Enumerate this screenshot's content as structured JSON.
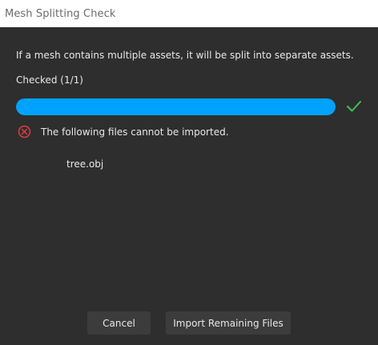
{
  "window": {
    "title": "Mesh Splitting Check"
  },
  "content": {
    "description": "If a mesh contains multiple assets, it will be split into separate assets.",
    "status": "Checked (1/1)",
    "progress": {
      "value": 1,
      "max": 1,
      "fill_color": "#00a2ff"
    },
    "error_message": "The following files cannot be imported.",
    "failed_files": [
      "tree.obj"
    ]
  },
  "buttons": {
    "cancel_label": "Cancel",
    "import_label": "Import Remaining Files"
  },
  "colors": {
    "background": "#2e2e2e",
    "accent": "#00a2ff",
    "success": "#3cc35a",
    "error": "#e03c3c"
  },
  "icons": {
    "success": "check-icon",
    "error": "error-circle-x-icon"
  }
}
